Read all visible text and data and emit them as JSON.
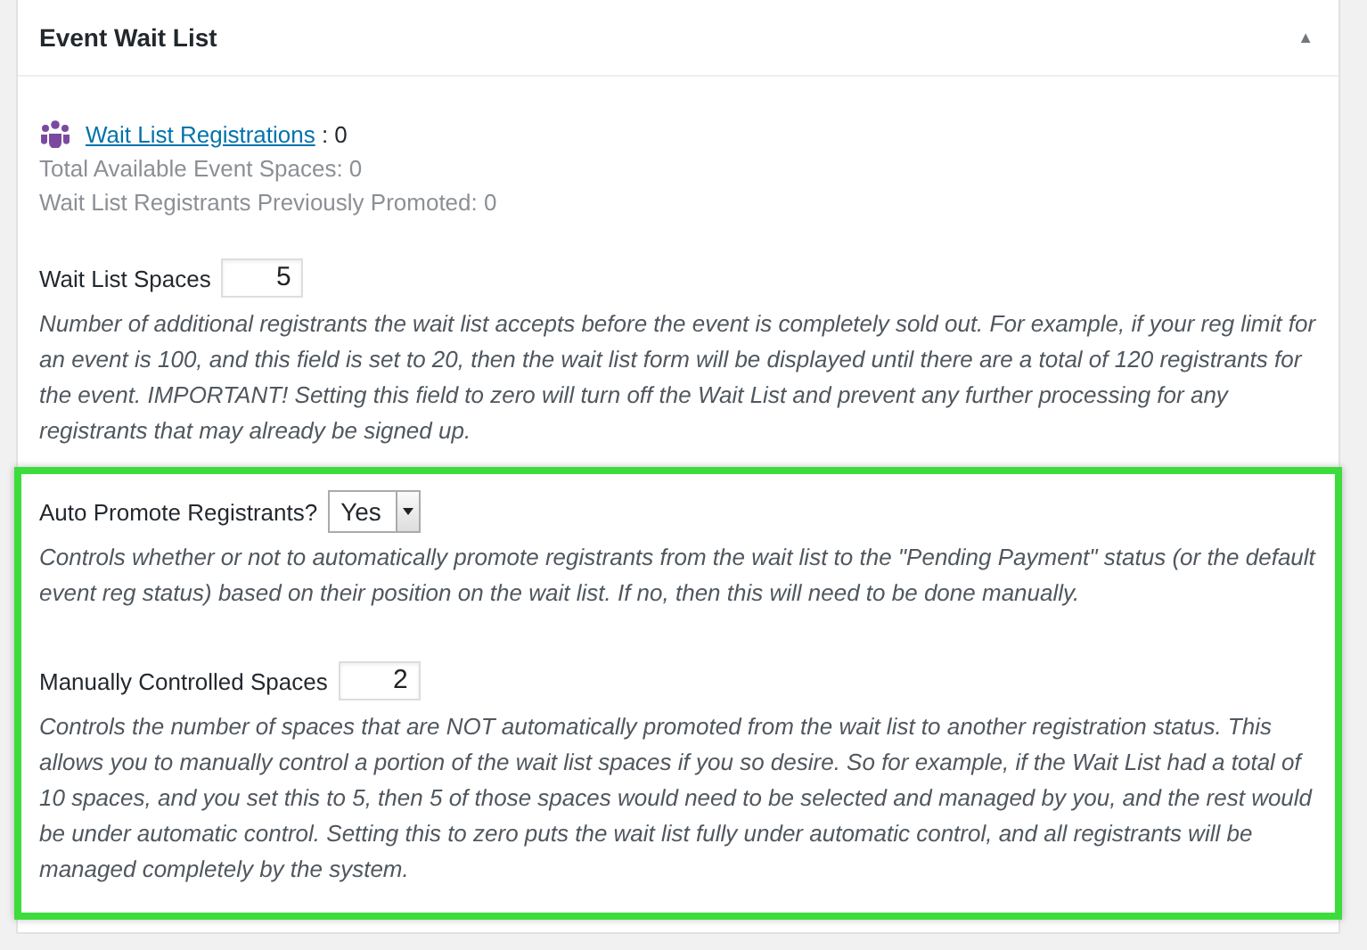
{
  "panel": {
    "title": "Event Wait List",
    "toggle": "▲"
  },
  "stats": {
    "link": "Wait List Registrations",
    "link_suffix": " : 0",
    "lines": [
      "Total Available Event Spaces: 0",
      "Wait List Registrants Previously Promoted: 0"
    ]
  },
  "groups": [
    {
      "highlighted": false,
      "settings": [
        {
          "kind": "number",
          "label": "Wait List Spaces",
          "value": "5",
          "description": "Number of additional registrants the wait list accepts before the event is completely sold out. For example, if your reg limit for an event is 100, and this field is set to 20, then the wait list form will be displayed until there are a total of 120 registrants for the event. IMPORTANT! Setting this field to zero will turn off the Wait List and prevent any further processing for any registrants that may already be signed up."
        }
      ]
    },
    {
      "highlighted": true,
      "settings": [
        {
          "kind": "select",
          "label": "Auto Promote Registrants?",
          "value": "Yes",
          "description": "Controls whether or not to automatically promote registrants from the wait list to the \"Pending Payment\" status (or the default event reg status) based on their position on the wait list. If no, then this will need to be done manually."
        },
        {
          "kind": "number",
          "label": "Manually Controlled Spaces",
          "value": "2",
          "description": "Controls the number of spaces that are NOT automatically promoted from the wait list to another registration status. This allows you to manually control a portion of the wait list spaces if you so desire. So for example, if the Wait List had a total of 10 spaces, and you set this to 5, then 5 of those spaces would need to be selected and managed by you, and the rest would be under automatic control. Setting this to zero puts the wait list fully under automatic control, and all registrants will be managed completely by the system."
        }
      ]
    }
  ]
}
